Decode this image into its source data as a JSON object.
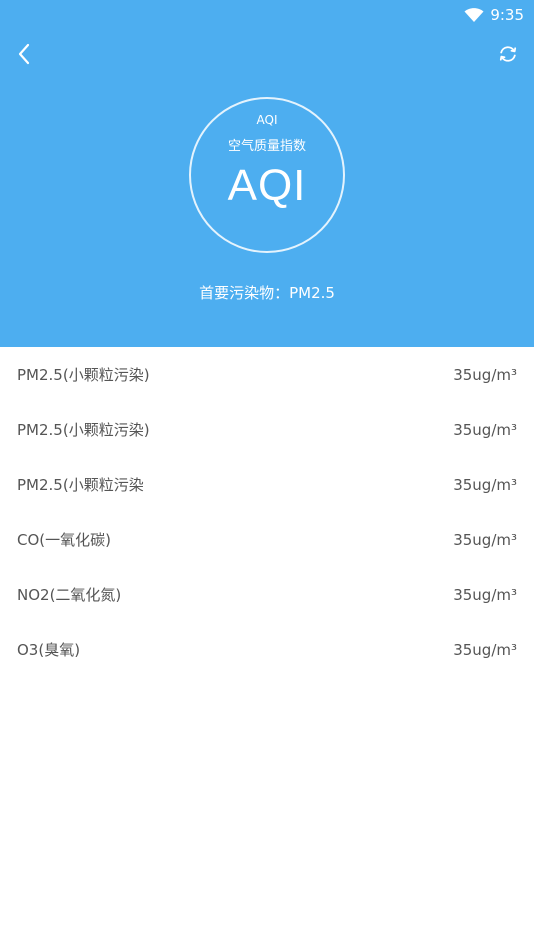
{
  "status_bar": {
    "time": "9:35",
    "wifi_icon": "wifi-icon"
  },
  "header": {
    "back_icon": "chevron-left-icon",
    "refresh_icon": "refresh-icon",
    "background_color": "#4daef0",
    "aqi_label": "AQI",
    "aqi_subtitle": "空气质量指数",
    "aqi_value": "AQI",
    "primary_pollutant": "首要污染物：PM2.5"
  },
  "pollutants": [
    {
      "name": "PM2.5(小颗粒污染)",
      "value": "35ug/m³"
    },
    {
      "name": "PM2.5(小颗粒污染)",
      "value": "35ug/m³"
    },
    {
      "name": "PM2.5(小颗粒污染",
      "value": "35ug/m³"
    },
    {
      "name": "CO(一氧化碳)",
      "value": "35ug/m³"
    },
    {
      "name": "NO2(二氧化氮)",
      "value": "35ug/m³"
    },
    {
      "name": "O3(臭氧)",
      "value": "35ug/m³"
    }
  ]
}
